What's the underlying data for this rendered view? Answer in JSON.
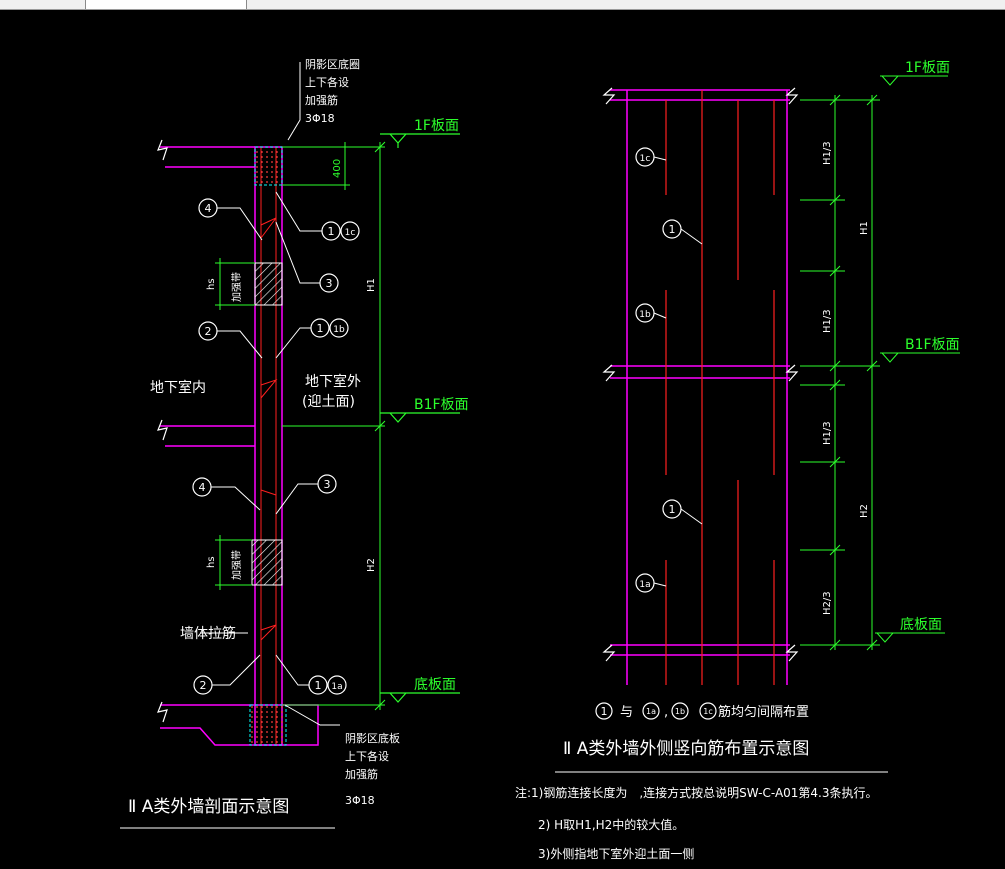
{
  "window": {
    "tab_label": ""
  },
  "section": {
    "title": "Ⅱ A类外墙剖面示意图",
    "top_note": [
      "阴影区底圈",
      "上下各设",
      "加强筋",
      "3Φ18"
    ],
    "bottom_note": [
      "阴影区底板",
      "上下各设",
      "加强筋",
      "3Φ18"
    ],
    "level_1f": "1F板面",
    "level_b1f": "B1F板面",
    "level_bottom": "底板面",
    "dim_400": "400",
    "dim_h1": "H1",
    "dim_h2": "H2",
    "hs": "hs",
    "jiaqiangdai": "加强带",
    "inside": "地下室内",
    "outside_1": "地下室外",
    "outside_2": "(迎土面)",
    "wall_tie": "墙体拉筋",
    "bubbles": {
      "b4": "4",
      "b1": "1",
      "b1c": "1c",
      "b3": "3",
      "b2": "2",
      "b1b": "1b",
      "b1a": "1a"
    }
  },
  "elevation": {
    "title": "Ⅱ A类外墙外侧竖向筋布置示意图",
    "level_1f": "1F板面",
    "level_b1f": "B1F板面",
    "level_bottom": "底板面",
    "dim_h1": "H1",
    "dim_h2": "H2",
    "dim_h1_3": "H1/3",
    "dim_h2_3": "H2/3",
    "bubbles": {
      "b1c": "1c",
      "b1": "1",
      "b1b": "1b",
      "b1a": "1a"
    },
    "legend": [
      "1",
      "与",
      "1a",
      ",",
      "1b",
      "1c",
      "筋均匀间隔布置"
    ]
  },
  "notes": [
    "注:1)钢筋连接长度为　,连接方式按总说明SW-C-A01第4.3条执行。",
    "2) H取H1,H2中的较大值。",
    "3)外侧指地下室外迎土面一侧"
  ],
  "colors": {
    "background": "#000000",
    "wall": "#ff00ff",
    "rebar": "#ff2020",
    "dimension": "#2cff2c",
    "text": "#ffffff",
    "hatch": "#00ffff"
  }
}
